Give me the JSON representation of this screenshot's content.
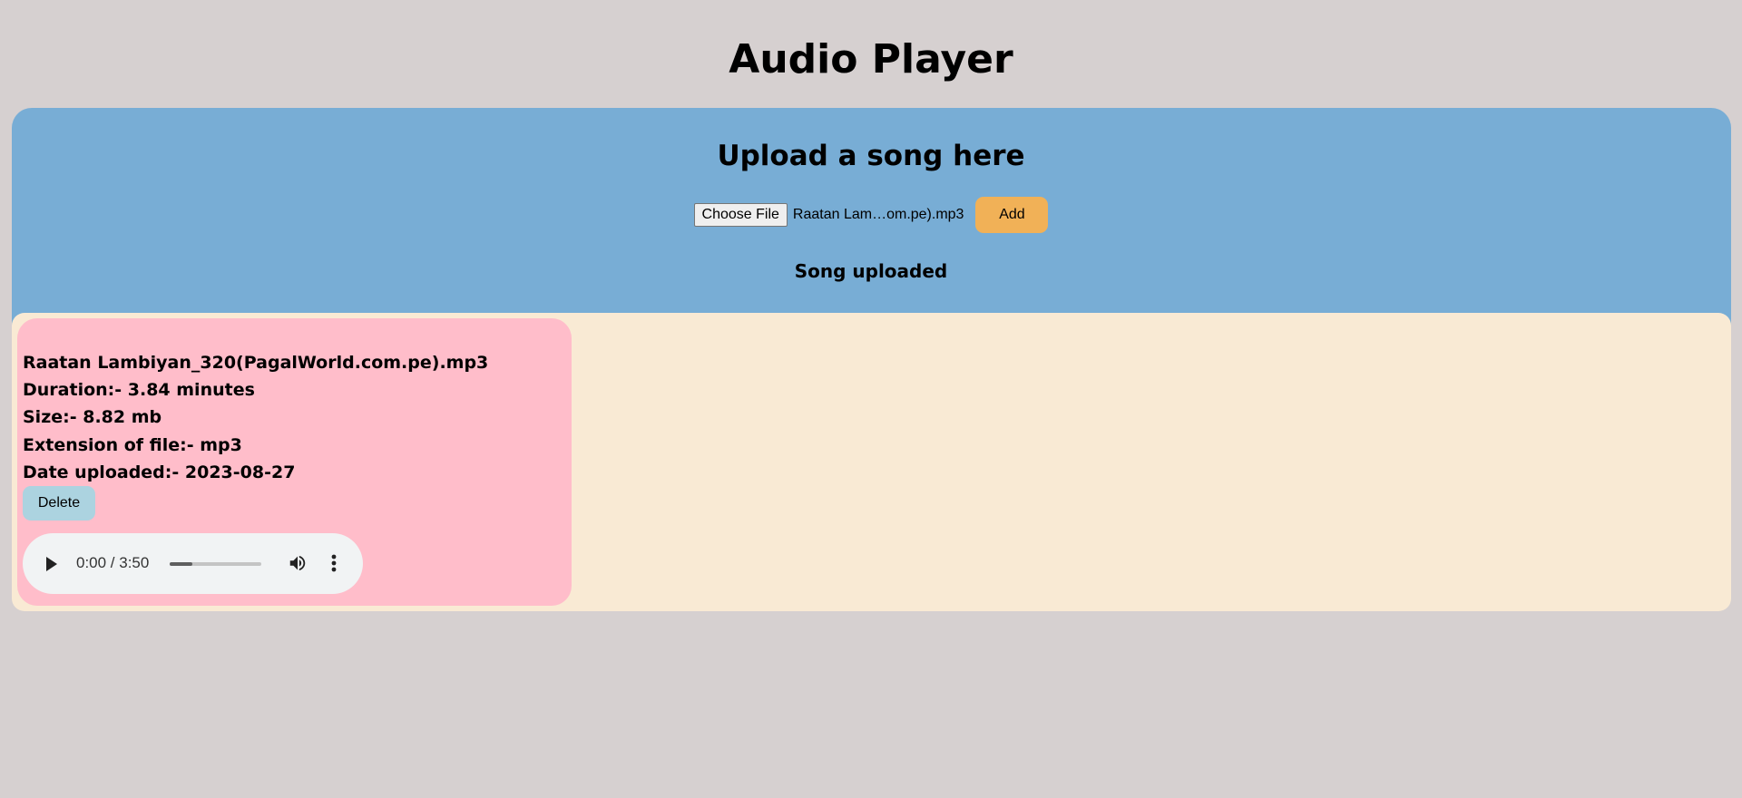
{
  "page": {
    "title": "Audio Player"
  },
  "upload": {
    "heading": "Upload a song here",
    "choose_file_label": "Choose File",
    "file_name": "Raatan Lam…om.pe).mp3",
    "add_label": "Add",
    "status": "Song uploaded"
  },
  "songs": [
    {
      "name": "Raatan Lambiyan_320(PagalWorld.com.pe).mp3",
      "duration": "Duration:- 3.84 minutes",
      "size": "Size:- 8.82 mb",
      "extension": "Extension of file:- mp3",
      "date_uploaded": "Date uploaded:- 2023-08-27",
      "delete_label": "Delete",
      "player": {
        "time": "0:00 / 3:50",
        "progress": 0.25
      }
    }
  ],
  "colors": {
    "background": "#d6d0d0",
    "upload_panel": "#78add5",
    "songs_panel": "#f9ead4",
    "song_card": "#ffbdca",
    "add_button": "#f1b157",
    "delete_button": "#acd3e0"
  },
  "icons": {
    "play": "play-icon",
    "volume": "volume-icon",
    "more": "more-vertical-icon"
  }
}
